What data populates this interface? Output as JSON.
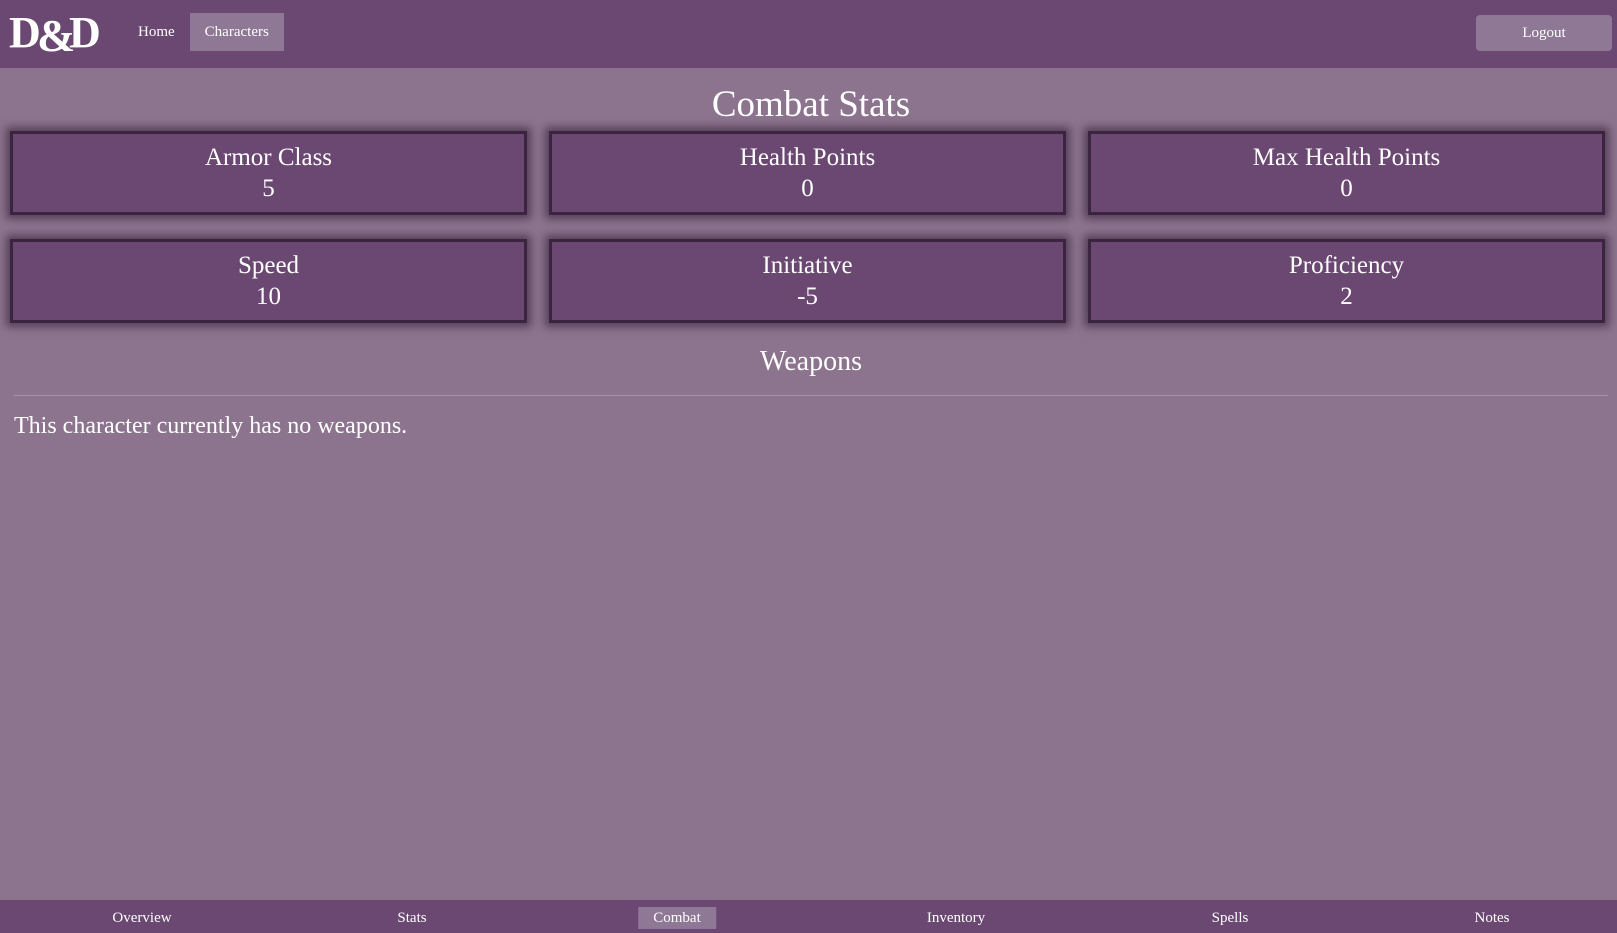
{
  "header": {
    "logo_text": "D&D",
    "nav": [
      {
        "label": "Home",
        "active": false
      },
      {
        "label": "Characters",
        "active": true
      }
    ],
    "logout_label": "Logout"
  },
  "combat": {
    "title": "Combat Stats",
    "stats": [
      {
        "label": "Armor Class",
        "value": "5"
      },
      {
        "label": "Health Points",
        "value": "0"
      },
      {
        "label": "Max Health Points",
        "value": "0"
      },
      {
        "label": "Speed",
        "value": "10"
      },
      {
        "label": "Initiative",
        "value": "-5"
      },
      {
        "label": "Proficiency",
        "value": "2"
      }
    ]
  },
  "weapons": {
    "title": "Weapons",
    "empty_message": "This character currently has no weapons."
  },
  "tabs": [
    {
      "label": "Overview",
      "active": false
    },
    {
      "label": "Stats",
      "active": false
    },
    {
      "label": "Combat",
      "active": true
    },
    {
      "label": "Inventory",
      "active": false
    },
    {
      "label": "Spells",
      "active": false
    },
    {
      "label": "Notes",
      "active": false
    }
  ],
  "colors": {
    "background": "#8c748e",
    "bar": "#6a4872",
    "active": "#8f7896",
    "card_border": "#3a2440"
  }
}
